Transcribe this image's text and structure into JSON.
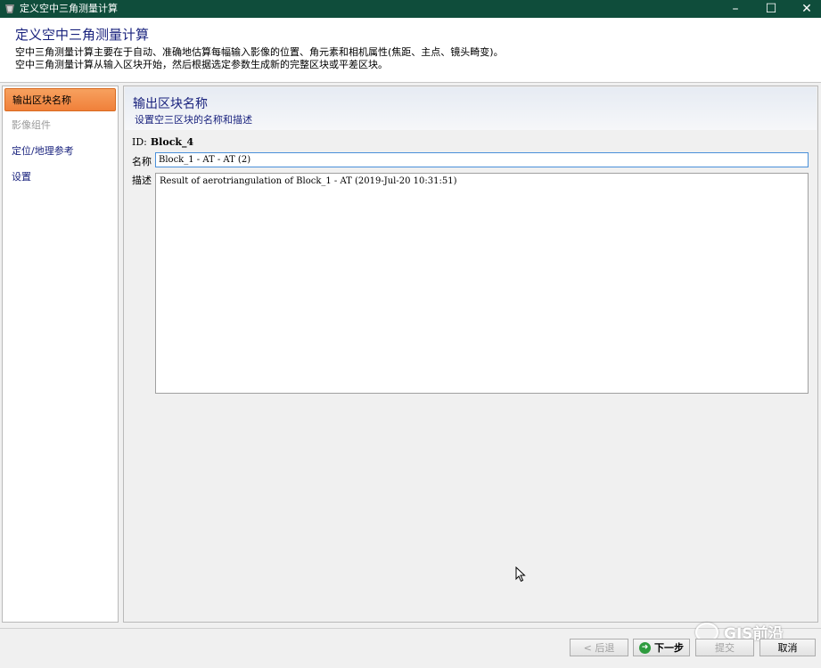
{
  "window": {
    "title": "定义空中三角测量计算",
    "controls": {
      "minimize": "–",
      "maximize": "☐",
      "close": "✕"
    }
  },
  "header": {
    "title": "定义空中三角测量计算",
    "desc_line1": "空中三角测量计算主要在于自动、准确地估算每幅输入影像的位置、角元素和相机属性(焦距、主点、镜头畸变)。",
    "desc_line2": "空中三角测量计算从输入区块开始，然后根据选定参数生成新的完整区块或平差区块。"
  },
  "nav": {
    "items": [
      {
        "label": "输出区块名称",
        "state": "active"
      },
      {
        "label": "影像组件",
        "state": "disabled"
      },
      {
        "label": "定位/地理参考",
        "state": "normal"
      },
      {
        "label": "设置",
        "state": "normal"
      }
    ]
  },
  "panel": {
    "title": "输出区块名称",
    "subtitle": "设置空三区块的名称和描述",
    "id_label": "ID:",
    "id_value": "Block_4",
    "name_label": "名称",
    "name_value": "Block_1 - AT - AT (2)",
    "desc_label": "描述",
    "desc_value": "Result of aerotriangulation of Block_1 - AT (2019-Jul-20 10:31:51)"
  },
  "buttons": {
    "back": "< 后退",
    "next": "下一步",
    "submit": "提交",
    "cancel": "取消"
  },
  "watermark": {
    "text": "GIS前沿"
  },
  "colors": {
    "titlebar": "#0f4d3b",
    "accent_text": "#1a237e",
    "active_nav": "#f0803a",
    "next_icon": "#2e9b3e"
  }
}
